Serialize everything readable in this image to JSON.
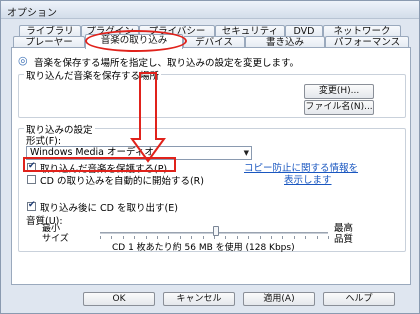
{
  "window": {
    "title": "オプション"
  },
  "tabs": {
    "row1": [
      "ライブラリ",
      "プラグイン",
      "プライバシー",
      "セキュリティ",
      "DVD",
      "ネットワーク"
    ],
    "row2": [
      "プレーヤー",
      "音楽の取り込み",
      "デバイス",
      "書き込み",
      "パフォーマンス"
    ],
    "active": "音楽の取り込み"
  },
  "intro": {
    "text": "音楽を保存する場所を指定し、取り込みの設定を変更します。"
  },
  "location": {
    "group_label": "取り込んだ音楽を保存する場所",
    "change_button": "変更(H)...",
    "filename_button": "ファイル名(N)..."
  },
  "settings": {
    "group_label": "取り込みの設定",
    "format_label": "形式(F):",
    "format_value": "Windows Media オーディオ",
    "protect_checkbox": {
      "label": "取り込んだ音楽を保護する(P)",
      "checked": true
    },
    "autorip_checkbox": {
      "label": "CD の取り込みを自動的に開始する(R)",
      "checked": false
    },
    "copy_protect_link_line1": "コピー防止に関する情報を",
    "copy_protect_link_line2": "表示します",
    "eject_checkbox": {
      "label": "取り込み後に CD を取り出す(E)",
      "checked": true
    },
    "quality_label": "音質(U):",
    "quality_min_label": "最小\nサイズ",
    "quality_max_label": "最高\n品質",
    "quality_level": 0.51,
    "quality_info": "CD 1 枚あたり約 56 MB を使用 (128 Kbps)"
  },
  "footer": {
    "ok_button": "OK",
    "cancel_button": "キャンセル",
    "apply_button": "適用(A)",
    "help_button": "ヘルプ"
  },
  "annotation_color": "#e0221b"
}
